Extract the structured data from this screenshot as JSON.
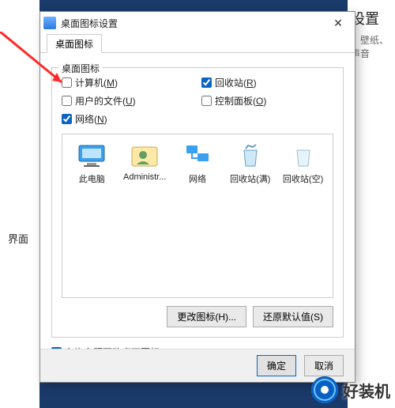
{
  "background": {
    "right_title_fragment": "设置",
    "right_sub_fragment": "、壁纸、声音",
    "left_item": "界面"
  },
  "dialog": {
    "title": "桌面图标设置",
    "tab_label": "桌面图标",
    "group_legend": "桌面图标",
    "checks": {
      "computer": {
        "label_pre": "计算机(",
        "hot": "M",
        "label_post": ")",
        "checked": false
      },
      "recycle": {
        "label_pre": "回收站(",
        "hot": "R",
        "label_post": ")",
        "checked": true
      },
      "userfiles": {
        "label_pre": "用户的文件(",
        "hot": "U",
        "label_post": ")",
        "checked": false
      },
      "ctrlpanel": {
        "label_pre": "控制面板(",
        "hot": "O",
        "label_post": ")",
        "checked": false
      },
      "network": {
        "label_pre": "网络(",
        "hot": "N",
        "label_post": ")",
        "checked": true
      }
    },
    "preview_icons": [
      {
        "key": "thispc",
        "label": "此电脑"
      },
      {
        "key": "user",
        "label": "Administr..."
      },
      {
        "key": "net",
        "label": "网络"
      },
      {
        "key": "rb_full",
        "label": "回收站(满)"
      },
      {
        "key": "rb_emp",
        "label": "回收站(空)"
      }
    ],
    "change_icon_btn": "更改图标(H)...",
    "restore_btn": "还原默认值(S)",
    "allow_theme": {
      "label_pre": "允许主题更改桌面图标(",
      "hot": "L",
      "label_post": ")",
      "checked": true
    },
    "ok": "确定",
    "cancel": "取消"
  },
  "watermark": "好装机"
}
